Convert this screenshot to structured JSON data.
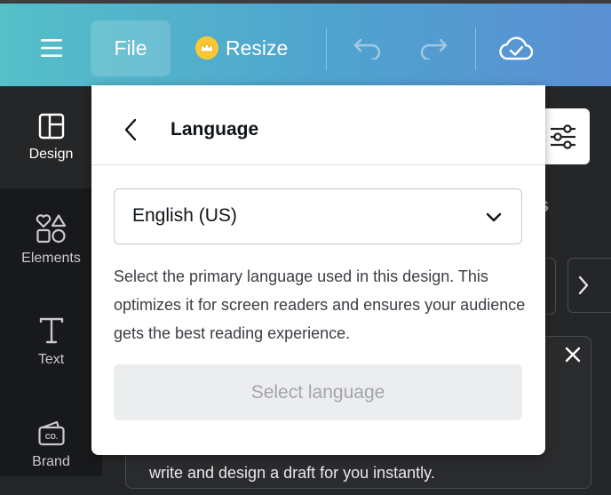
{
  "toolbar": {
    "file_label": "File",
    "resize_label": "Resize"
  },
  "sidebar": {
    "items": [
      {
        "label": "Design",
        "icon": "design-icon"
      },
      {
        "label": "Elements",
        "icon": "elements-icon"
      },
      {
        "label": "Text",
        "icon": "text-icon"
      },
      {
        "label": "Brand",
        "icon": "brand-icon"
      }
    ]
  },
  "background": {
    "partial_heading": "s",
    "partial_text": "write and design a draft for you instantly."
  },
  "popup": {
    "title": "Language",
    "selected_language": "English (US)",
    "description": "Select the primary language used in this design. This optimizes it for screen readers and ensures your audience gets the best reading experience.",
    "action_label": "Select language"
  },
  "colors": {
    "topbar_start": "#55c0c8",
    "topbar_end": "#5b8fd3",
    "crown": "#ffc832",
    "sidebar_bg": "#18191b",
    "canvas_bg": "#252627"
  }
}
